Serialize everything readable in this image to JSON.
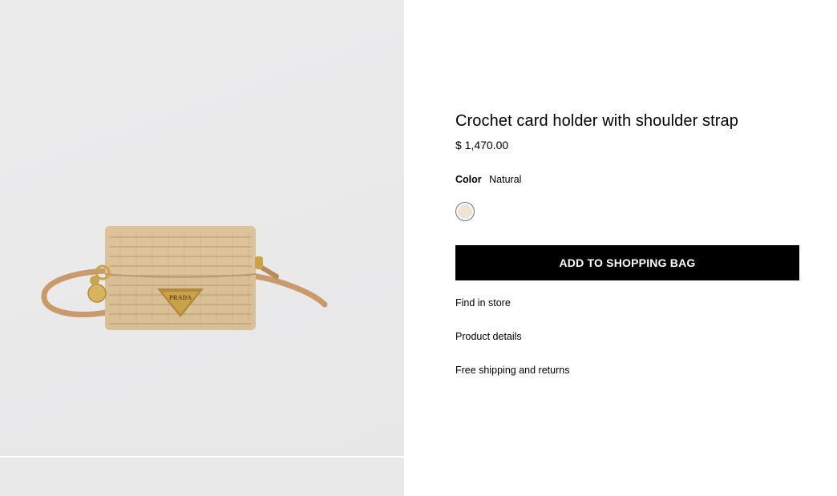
{
  "product": {
    "title": "Crochet card holder with shoulder strap",
    "price": "$ 1,470.00",
    "color_label": "Color",
    "color_value": "Natural",
    "swatch_color": "#efe4d1",
    "add_to_bag_label": "ADD TO SHOPPING BAG"
  },
  "links": {
    "find_in_store": "Find in store",
    "product_details": "Product details",
    "shipping": "Free shipping and returns"
  },
  "image": {
    "logo_text": "PRADA",
    "bag_color": "#dcc39a",
    "strap_color": "#c99a6a",
    "hardware_color": "#c9a24a"
  }
}
